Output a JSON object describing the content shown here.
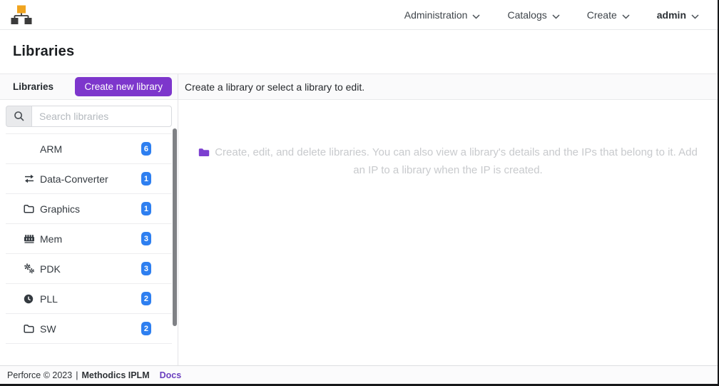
{
  "header": {
    "nav": [
      {
        "label": "Administration"
      },
      {
        "label": "Catalogs"
      },
      {
        "label": "Create"
      },
      {
        "label": "admin"
      }
    ]
  },
  "page": {
    "title": "Libraries"
  },
  "toolbar": {
    "section_label": "Libraries",
    "create_button_label": "Create new library",
    "helper_text": "Create a library or select a library to edit."
  },
  "sidebar": {
    "search_placeholder": "Search libraries",
    "items": [
      {
        "label": "ARM",
        "count": "6",
        "icon": "none"
      },
      {
        "label": "Data-Converter",
        "count": "1",
        "icon": "swap-arrows"
      },
      {
        "label": "Graphics",
        "count": "1",
        "icon": "folder-outline"
      },
      {
        "label": "Mem",
        "count": "3",
        "icon": "memory-chip"
      },
      {
        "label": "PDK",
        "count": "3",
        "icon": "gears"
      },
      {
        "label": "PLL",
        "count": "2",
        "icon": "clock"
      },
      {
        "label": "SW",
        "count": "2",
        "icon": "folder-outline"
      }
    ],
    "has_more_partially_visible": true
  },
  "main": {
    "empty_state_text": "Create, edit, and delete libraries. You can also view a library's details and the IPs that belong to it. Add an IP to a library when the IP is created."
  },
  "footer": {
    "copyright": "Perforce © 2023",
    "separator": "|",
    "product": "Methodics IPLM",
    "docs_label": "Docs"
  },
  "colors": {
    "accent_purple": "#7d36cc",
    "badge_blue": "#2e7ff0",
    "folder_purple": "#7c3fd0",
    "logo_orange": "#f0a41f"
  }
}
